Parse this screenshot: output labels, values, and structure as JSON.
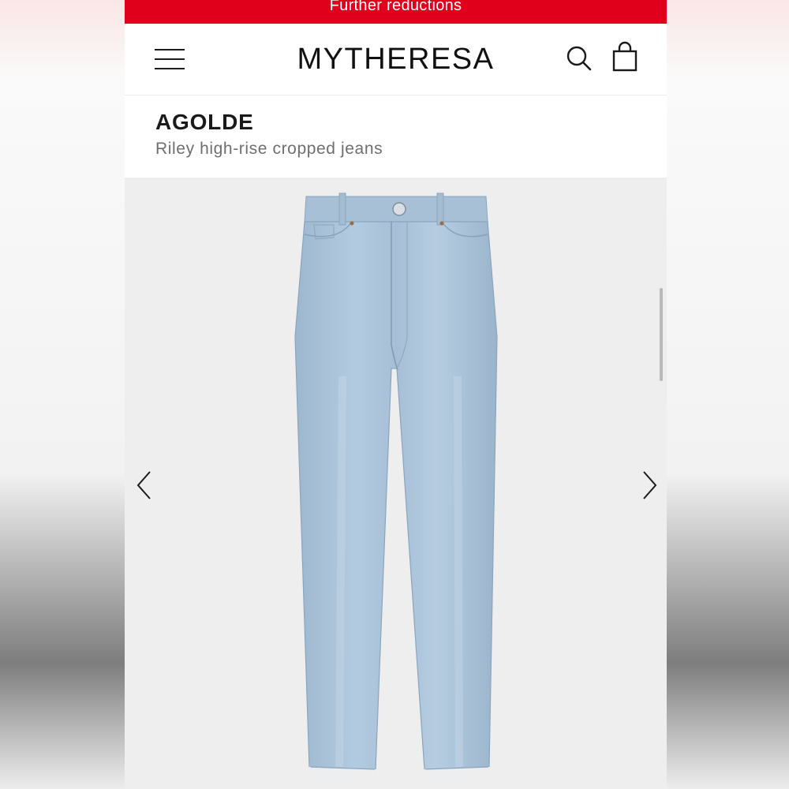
{
  "promo": {
    "text": "Further reductions"
  },
  "header": {
    "logo": "MYTHERESA",
    "icons": {
      "menu": "hamburger-menu-icon",
      "search": "search-icon",
      "cart": "shopping-bag-icon"
    }
  },
  "product": {
    "brand": "AGOLDE",
    "name": "Riley high-rise cropped jeans"
  },
  "gallery": {
    "image": "light-wash denim jeans",
    "icons": {
      "previous": "chevron-left-icon",
      "next": "chevron-right-icon"
    }
  },
  "colors": {
    "promo_bg": "#e0001b",
    "denim": "#a9c3d9",
    "gallery_bg": "#eeeeee"
  }
}
